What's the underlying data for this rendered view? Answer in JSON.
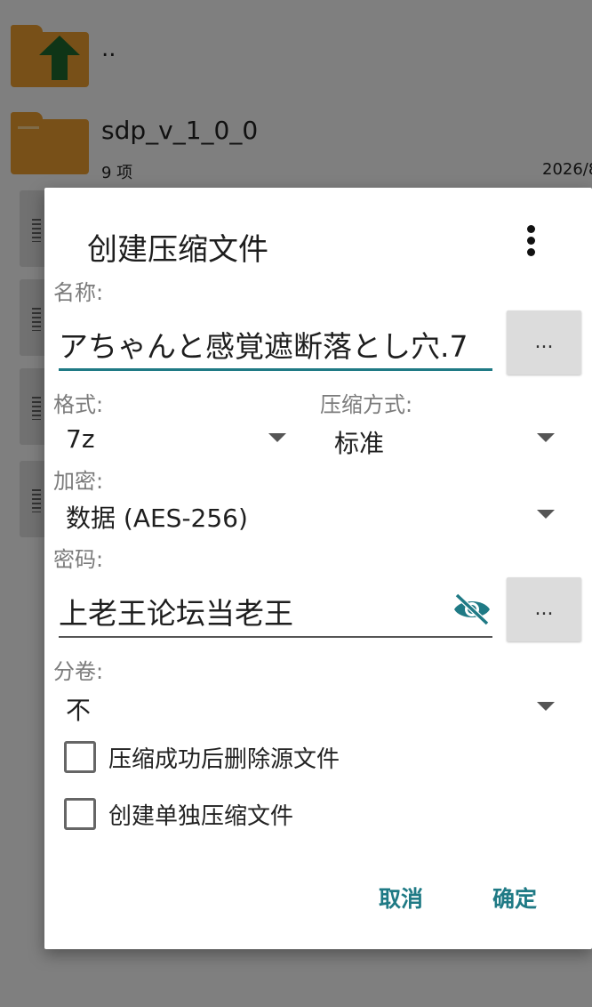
{
  "background": {
    "items": [
      {
        "name": "..",
        "meta": ""
      },
      {
        "name": "sdp_v_1_0_0",
        "meta": "9 项",
        "date": "2026/8"
      }
    ]
  },
  "dialog": {
    "title": "创建压缩文件",
    "name_label": "名称:",
    "name_value": "アちゃんと感覚遮断落とし穴.7",
    "browse_label": "...",
    "format_label": "格式:",
    "format_value": "7z",
    "compression_label": "压缩方式:",
    "compression_value": "标准",
    "encryption_label": "加密:",
    "encryption_value": "数据 (AES-256)",
    "password_label": "密码:",
    "password_value": "上老王论坛当老王",
    "password_button_label": "...",
    "split_label": "分卷:",
    "split_value": "不",
    "checkbox_delete_label": "压缩成功后删除源文件",
    "checkbox_separate_label": "创建单独压缩文件",
    "cancel_label": "取消",
    "ok_label": "确定"
  },
  "colors": {
    "accent": "#1f7a85",
    "folder": "#f0a030"
  }
}
